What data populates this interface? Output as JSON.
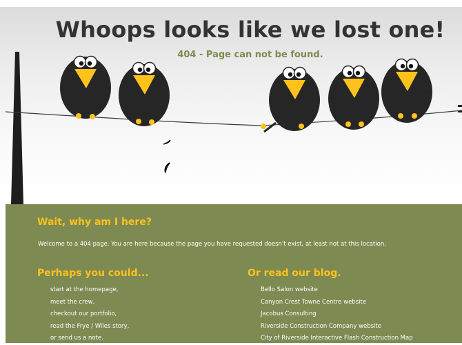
{
  "hero": {
    "headline": "Whoops looks like we lost one!",
    "subtitle": "404 - Page can not be found."
  },
  "explanation": {
    "heading": "Wait, why am I here?",
    "text": "Welcome to a 404 page. You are here because the page you have requested doesn't exist, at least not at this location."
  },
  "suggestions": {
    "heading": "Perhaps you could...",
    "items": [
      "start at the homepage,",
      "meet the crew,",
      "checkout our portfolio,",
      "read the Frye / Wiles story,",
      "or send us a note."
    ]
  },
  "blog": {
    "heading": "Or read our blog.",
    "items": [
      "Bello Salon website",
      "Canyon Crest Towne Centre website",
      "Jacobus Consulting",
      "Riverside Construction Company website",
      "City of Riverside Interactive Flash Construction Map"
    ]
  },
  "colors": {
    "panel": "#7d8a51",
    "accent": "#ffc21d",
    "subtitle": "#7c8b4f",
    "headline": "#333333"
  },
  "icons": [
    "crow-illustration",
    "utility-pole",
    "falling-feather"
  ]
}
